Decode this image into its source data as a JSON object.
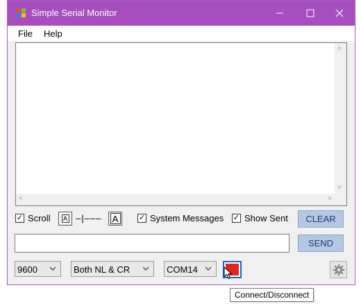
{
  "window": {
    "title": "Simple Serial Monitor"
  },
  "title_buttons": {
    "minimize": "—",
    "maximize": "☐",
    "close": "✕"
  },
  "menu": {
    "file": "File",
    "help": "Help"
  },
  "controls": {
    "scroll_label": "Scroll",
    "scroll_checked": true,
    "font_small_glyph": "A",
    "font_slider_glyph": "–|–––",
    "font_large_glyph": "A",
    "system_messages_label": "System Messages",
    "system_messages_checked": true,
    "show_sent_label": "Show Sent",
    "show_sent_checked": true,
    "clear_label": "CLEAR",
    "send_label": "SEND",
    "send_input_value": ""
  },
  "bottom": {
    "baud_rate": "9600",
    "line_ending": "Both NL & CR",
    "port": "COM14",
    "connect_state_color": "#e8231f"
  },
  "tooltip": {
    "text": "Connect/Disconnect"
  },
  "colors": {
    "titlebar": "#a64dbf",
    "accent_button": "#b4c8e3",
    "focus_border": "#1e64c8"
  }
}
